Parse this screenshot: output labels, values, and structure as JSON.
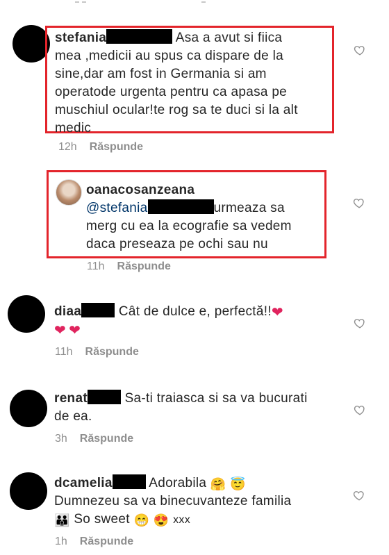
{
  "comments": [
    {
      "username": "stefania",
      "text_lines": [
        "Asa a avut si fiica",
        "mea ,medicii au spus ca dispare de la",
        "sine,dar am fost in Germania si am",
        "operatode urgenta pentru ca apasa pe",
        "muschiul ocular!te rog sa te duci si la alt",
        "medic"
      ],
      "time": "12h",
      "reply_label": "Răspunde"
    },
    {
      "username": "oanacosanzeana",
      "mention": "@stefania",
      "text_lines": [
        "urmeaza sa",
        "merg cu ea la ecografie sa vedem",
        "daca preseaza pe ochi sau nu"
      ],
      "time": "11h",
      "reply_label": "Răspunde"
    },
    {
      "username": "diaa",
      "text": "Cât de dulce e, perfectă!!",
      "time": "11h",
      "reply_label": "Răspunde"
    },
    {
      "username": "renat",
      "text_lines": [
        "Sa-ti traiasca si sa va bucurati",
        "de ea."
      ],
      "time": "3h",
      "reply_label": "Răspunde"
    },
    {
      "username": "dcamelia",
      "text_lines": [
        "Adorabila",
        "Dumnezeu sa va binecuvanteze familia",
        "So sweet",
        "xxx"
      ],
      "time": "1h",
      "reply_label": "Răspunde"
    }
  ],
  "colors": {
    "highlight_border": "#e3242b",
    "username": "#262626",
    "meta": "#8e8e8e",
    "mention": "#003569"
  }
}
